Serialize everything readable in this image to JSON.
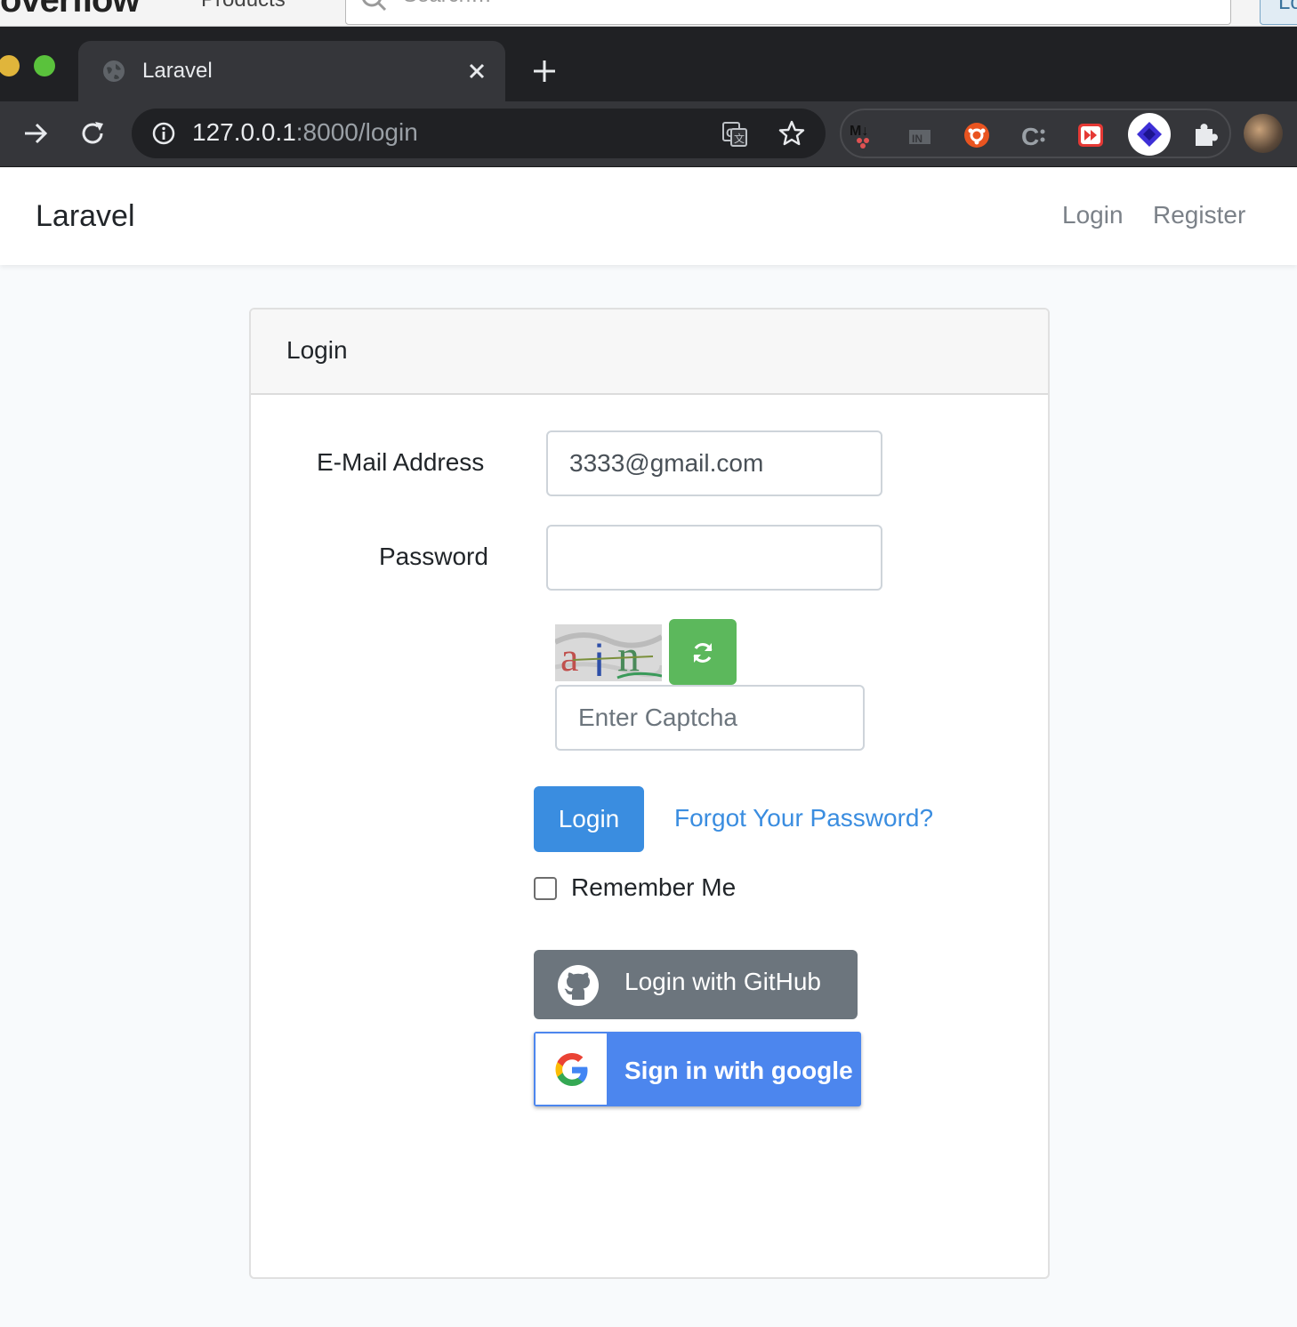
{
  "background_page": {
    "logo_text": "overflow",
    "products_label": "Products",
    "search_placeholder": "Search…",
    "button_fragment": "Lo"
  },
  "browser": {
    "tab_title": "Laravel",
    "url_host": "127.0.0.1",
    "url_rest": ":8000/login",
    "extensions": [
      "markdown-icon",
      "notion-icon",
      "ubuntu-icon",
      "cssviewer-icon",
      "speed-icon",
      "layers-icon",
      "puzzle-icon"
    ]
  },
  "navbar": {
    "brand": "Laravel",
    "login_link": "Login",
    "register_link": "Register"
  },
  "card": {
    "title": "Login",
    "email_label": "E-Mail Address",
    "email_value": "3333@gmail.com",
    "password_label": "Password",
    "password_value": "",
    "captcha_placeholder": "Enter Captcha",
    "captcha_text": "ain",
    "login_button": "Login",
    "forgot_link": "Forgot Your Password?",
    "remember_label": "Remember Me",
    "remember_checked": false,
    "github_button": "Login with GitHub",
    "google_button": "Sign in with google"
  },
  "colors": {
    "primary": "#3a8de0",
    "success": "#5cb85c",
    "secondary": "#6c757d",
    "google_blue": "#4c86ee"
  }
}
